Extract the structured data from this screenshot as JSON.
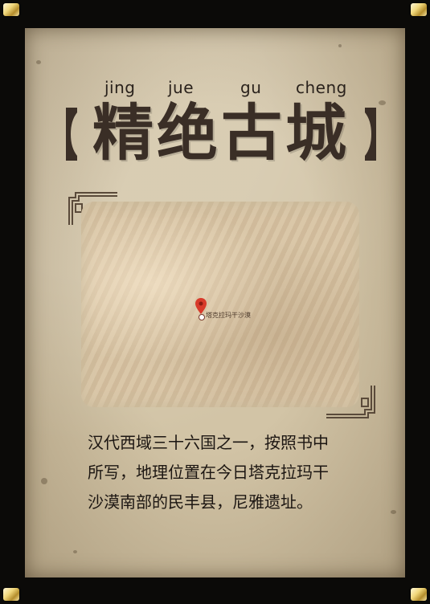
{
  "title": {
    "pinyin": [
      "jing",
      "jue",
      "gu",
      "cheng"
    ],
    "text": "精绝古城",
    "bracket_left": "【",
    "bracket_right": "】"
  },
  "map": {
    "marker_label": "塔克拉玛干沙漠"
  },
  "description": {
    "lines": [
      "汉代西域三十六国之一，按照书中",
      "所写，地理位置在今日塔克拉玛干",
      "沙漠南部的民丰县，尼雅遗址。"
    ]
  },
  "colors": {
    "paper": "#d2c4a6",
    "frame": "#0b0a08",
    "title": "#3a2e26",
    "corner_gold": "#e8cd70",
    "pin": "#d83a2a"
  }
}
